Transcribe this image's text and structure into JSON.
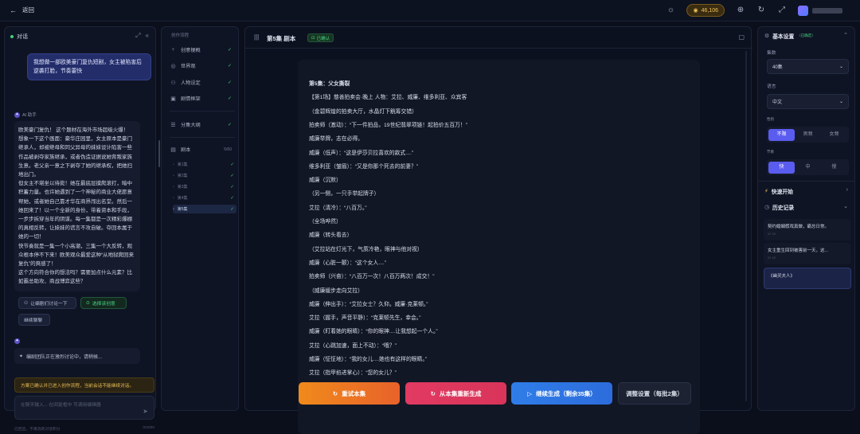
{
  "topbar": {
    "back_label": "返回",
    "coins": "46,106"
  },
  "chat": {
    "title": "对话",
    "user_message": "我想做一部欧美豪门复仇短剧，女主被陷害后逆袭打脸，节奏要快",
    "bot_name": "AI 助手",
    "bot_message": "欧美豪门复仇！ 这个题材在海外市场超级火爆！\n想象一下这个画面：豪华庄园里，女主原本是豪门继承人，却被继母和同父异母的妹妹设计陷害一些作品被剥夺家族继承，或者伪造证据说她背叛家族生意。老父亲一意之下剥夺了她的继承权，把她扫地出门。\n但女主不堪坐以待毙！她在最底层摸爬滚打，暗中积蓄力量。也许她遇到了一个神秘的商业大佬愿意帮她，或者她自己靠才华在商界闯出名堂。然后一她回来了！以一个全新的身份，带着资本和手段，一步步拆穿当年的阴谋。每一集都是一次精彩爆棚的真相反转，让妹妹的谎言不攻自破。夺回本属于她的一切！\n快节奏就是一集一个小高潮，三集一个大反转，观众根本停不下来！欧美观众最爱这种“从地狱爬回来复仇”的爽感了！\n这个方向符合你的想法吗？需要加点什么元素？比如霸总助攻、商战博弈这些？",
    "btn_discuss": "让编剧们讨论一下",
    "btn_select": "选择该创意",
    "btn_continue": "继续聊聊",
    "system_message": "编剧团队正在激烈讨论中，请稍候...",
    "warning": "方案已确认并已进入创作流程，当前会话不能继续对话。",
    "input_placeholder": "在聊天输入...  在回复框中 可调用编辑器",
    "footer_left": "已回显，不再消耗对话积分",
    "footer_right": "0/2000"
  },
  "steps": {
    "title": "创作流程",
    "items": [
      {
        "label": "创意梗概",
        "icon": "bulb-icon"
      },
      {
        "label": "世界观",
        "icon": "globe-icon"
      },
      {
        "label": "人物设定",
        "icon": "users-icon"
      },
      {
        "label": "剧情框架",
        "icon": "frame-icon"
      }
    ],
    "outline": "分集大纲",
    "script": "剧本",
    "script_count": "5/60",
    "episodes": [
      "第1集",
      "第2集",
      "第3集",
      "第4集",
      "第5集"
    ]
  },
  "main": {
    "title": "第5集  剧本",
    "badge": "已确认",
    "lines": [
      "第5集：父女撕裂",
      "【第1场】慈善拍卖会·晚上  人物：艾拉、威廉、维多利亚、众宾客",
      "（金碧辉煌的拍卖大厅，水晶灯下觥筹交错）",
      "拍卖师（激动）：“下一件拍品，19世纪翡翠项链！起拍价五百万！”",
      "威廉举牌，志在必得。",
      "威廉（低声）：“这是伊莎贝拉喜欢的款式....”",
      "维多利亚（皱眉）：“又是你那个死去的前妻？”",
      "威廉（沉默）",
      "（另一侧，一只手举起牌子）",
      "艾拉（清冷）：“八百万。”",
      "（全场哗然）",
      "威廉（转头看去）",
      "（艾拉站在灯光下，气质冷艳，眼神与他对视）",
      "威廉（心脏一颤）：“这个女人....”",
      "拍卖师（兴奋）：“八百万一次！八百万两次！成交！”",
      "（威廉缓步走向艾拉）",
      "威廉（伸出手）：“艾拉女士？久仰。威廉·克莱顿。”",
      "艾拉（握手，声音平静）：“克莱顿先生，幸会。”",
      "威廉（盯着她的眼睛）：“你的眼神....让我想起一个人。”",
      "艾拉（心跳加速，面上不动）：“哦？”",
      "威廉（怔怔地）：“我的女儿....她也有这样的眼睛。”",
      "艾拉（指甲掐进掌心）：“您的女儿？”"
    ],
    "btn_retry": "重试本集",
    "btn_regen": "从本集重新生成",
    "btn_continue": "继续生成（剩余35集）",
    "btn_adjust": "调整设置（每批2集）"
  },
  "settings": {
    "title": "基本设置",
    "title_tag": "（已确定）",
    "episodes_label": "集数",
    "episodes_value": "40集",
    "language_label": "语言",
    "language_value": "中文",
    "gender_label": "性别",
    "gender_options": [
      "不限",
      "男频",
      "女频"
    ],
    "pace_label": "节奏",
    "pace_options": [
      "快",
      "中",
      "慢"
    ],
    "quick_start": "快速开始",
    "history": "历史记录",
    "history_items": [
      {
        "title": "契约婚姻假戏真做，霸总日常。",
        "time": "07-20"
      },
      {
        "title": "女主重生回到被害前一天，这...",
        "time": "07-20"
      },
      {
        "title": "《幽灵夫人》",
        "time": ""
      }
    ]
  },
  "colors": {
    "accent": "#5a5cf0",
    "success": "#3fd17b",
    "orange": "#f07a1c",
    "pink": "#e23a62",
    "blue": "#2f7de8",
    "warning": "#e8be57"
  }
}
